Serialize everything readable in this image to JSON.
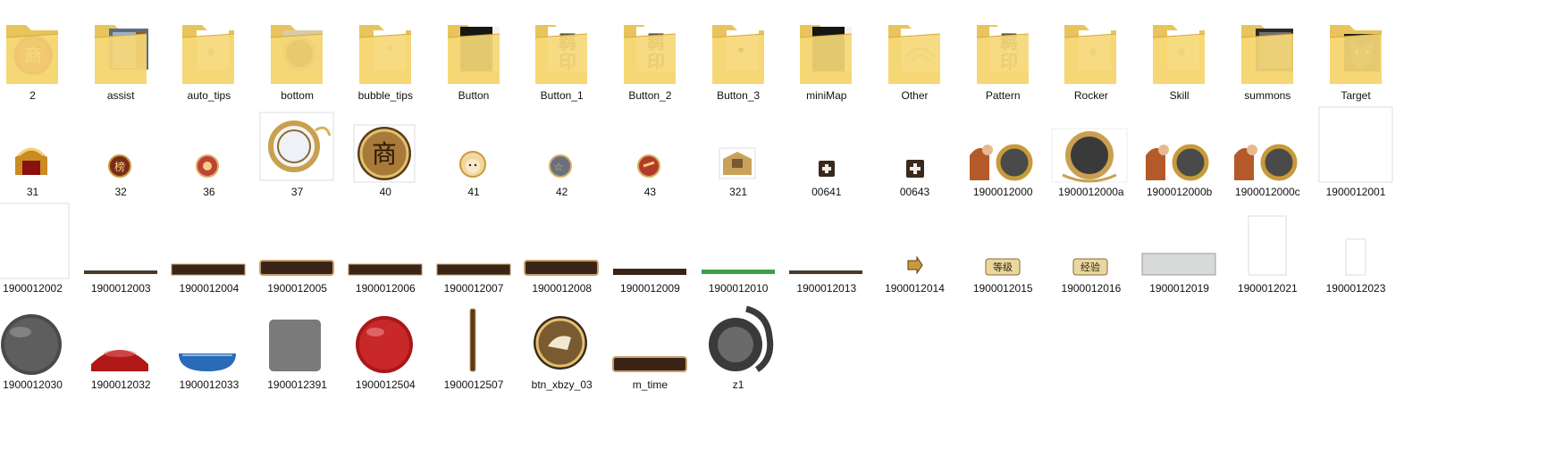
{
  "explorer": {
    "rows": [
      {
        "items": [
          {
            "name": "2",
            "kind": "folder",
            "preview": "red-seal",
            "icon": "folder-icon"
          },
          {
            "name": "assist",
            "kind": "folder",
            "preview": "steel-panel",
            "icon": "folder-icon"
          },
          {
            "name": "auto_tips",
            "kind": "folder",
            "preview": "small-dot",
            "icon": "folder-icon"
          },
          {
            "name": "bottom",
            "kind": "folder",
            "preview": "bronze-ring",
            "icon": "folder-icon"
          },
          {
            "name": "bubble_tips",
            "kind": "folder",
            "preview": "gold-dot",
            "icon": "folder-icon"
          },
          {
            "name": "Button",
            "kind": "folder",
            "preview": "dark-panel",
            "icon": "folder-icon"
          },
          {
            "name": "Button_1",
            "kind": "folder",
            "preview": "gold-glyphs",
            "icon": "folder-icon"
          },
          {
            "name": "Button_2",
            "kind": "folder",
            "preview": "gold-glyphs",
            "icon": "folder-icon"
          },
          {
            "name": "Button_3",
            "kind": "folder",
            "preview": "dark-dot",
            "icon": "folder-icon"
          },
          {
            "name": "miniMap",
            "kind": "folder",
            "preview": "dark-panel",
            "icon": "folder-icon"
          },
          {
            "name": "Other",
            "kind": "folder",
            "preview": "wifi-arcs",
            "icon": "folder-icon"
          },
          {
            "name": "Pattern",
            "kind": "folder",
            "preview": "gold-glyphs",
            "icon": "folder-icon"
          },
          {
            "name": "Rocker",
            "kind": "folder",
            "preview": "small-dot",
            "icon": "folder-icon"
          },
          {
            "name": "Skill",
            "kind": "folder",
            "preview": "small-dot",
            "icon": "folder-icon"
          },
          {
            "name": "summons",
            "kind": "folder",
            "preview": "grey-panel",
            "icon": "folder-icon"
          },
          {
            "name": "Target",
            "kind": "folder",
            "preview": "wolf-head",
            "icon": "folder-icon"
          }
        ]
      },
      {
        "items": [
          {
            "name": "31",
            "kind": "image",
            "preview": "gold-gate",
            "icon": "image-thumbnail"
          },
          {
            "name": "32",
            "kind": "image",
            "preview": "rank-badge",
            "icon": "image-thumbnail"
          },
          {
            "name": "36",
            "kind": "image",
            "preview": "pig-badge",
            "icon": "image-thumbnail"
          },
          {
            "name": "37",
            "kind": "image",
            "preview": "gold-ring-large",
            "icon": "image-thumbnail"
          },
          {
            "name": "40",
            "kind": "image",
            "preview": "shop-coin",
            "icon": "image-thumbnail",
            "glyph": "商"
          },
          {
            "name": "41",
            "kind": "image",
            "preview": "face-badge",
            "icon": "image-thumbnail"
          },
          {
            "name": "42",
            "kind": "image",
            "preview": "gift-badge",
            "icon": "image-thumbnail"
          },
          {
            "name": "43",
            "kind": "image",
            "preview": "hands-badge",
            "icon": "image-thumbnail"
          },
          {
            "name": "321",
            "kind": "image",
            "preview": "gold-gate-small",
            "icon": "image-thumbnail"
          },
          {
            "name": "00641",
            "kind": "image",
            "preview": "plus-box",
            "icon": "image-thumbnail"
          },
          {
            "name": "00643",
            "kind": "image",
            "preview": "plus-box-lg",
            "icon": "image-thumbnail"
          },
          {
            "name": "1900012000",
            "kind": "image",
            "preview": "warrior-ring",
            "icon": "image-thumbnail"
          },
          {
            "name": "1900012000a",
            "kind": "image",
            "preview": "ring-frame",
            "icon": "image-thumbnail"
          },
          {
            "name": "1900012000b",
            "kind": "image",
            "preview": "warrior-ring",
            "icon": "image-thumbnail"
          },
          {
            "name": "1900012000c",
            "kind": "image",
            "preview": "warrior-ring",
            "icon": "image-thumbnail"
          },
          {
            "name": "1900012001",
            "kind": "image",
            "preview": "blank-tall",
            "icon": "image-thumbnail"
          }
        ]
      },
      {
        "items": [
          {
            "name": "1900012002",
            "kind": "image",
            "preview": "blank-square",
            "icon": "image-thumbnail"
          },
          {
            "name": "1900012003",
            "kind": "image",
            "preview": "thin-bar",
            "icon": "image-thumbnail"
          },
          {
            "name": "1900012004",
            "kind": "image",
            "preview": "brown-bar",
            "icon": "image-thumbnail"
          },
          {
            "name": "1900012005",
            "kind": "image",
            "preview": "brown-bar-rounded",
            "icon": "image-thumbnail"
          },
          {
            "name": "1900012006",
            "kind": "image",
            "preview": "brown-bar",
            "icon": "image-thumbnail"
          },
          {
            "name": "1900012007",
            "kind": "image",
            "preview": "brown-bar",
            "icon": "image-thumbnail"
          },
          {
            "name": "1900012008",
            "kind": "image",
            "preview": "brown-bar-rounded",
            "icon": "image-thumbnail"
          },
          {
            "name": "1900012009",
            "kind": "image",
            "preview": "brown-bar-thin",
            "icon": "image-thumbnail"
          },
          {
            "name": "1900012010",
            "kind": "image",
            "preview": "green-bar",
            "icon": "image-thumbnail"
          },
          {
            "name": "1900012013",
            "kind": "image",
            "preview": "thin-bar",
            "icon": "image-thumbnail"
          },
          {
            "name": "1900012014",
            "kind": "image",
            "preview": "arrow-badge",
            "icon": "image-thumbnail"
          },
          {
            "name": "1900012015",
            "kind": "image",
            "preview": "text-badge",
            "icon": "image-thumbnail",
            "glyph": "等级"
          },
          {
            "name": "1900012016",
            "kind": "image",
            "preview": "text-badge",
            "icon": "image-thumbnail",
            "glyph": "经验"
          },
          {
            "name": "1900012019",
            "kind": "image",
            "preview": "grey-rect",
            "icon": "image-thumbnail"
          },
          {
            "name": "1900012021",
            "kind": "image",
            "preview": "blank-tall-small",
            "icon": "image-thumbnail"
          },
          {
            "name": "1900012023",
            "kind": "image",
            "preview": "blank-small",
            "icon": "image-thumbnail"
          }
        ]
      },
      {
        "items": [
          {
            "name": "1900012030",
            "kind": "image",
            "preview": "dark-orb",
            "icon": "image-thumbnail"
          },
          {
            "name": "1900012032",
            "kind": "image",
            "preview": "red-half-orb",
            "icon": "image-thumbnail"
          },
          {
            "name": "1900012033",
            "kind": "image",
            "preview": "blue-half-orb",
            "icon": "image-thumbnail"
          },
          {
            "name": "1900012391",
            "kind": "image",
            "preview": "grey-square",
            "icon": "image-thumbnail"
          },
          {
            "name": "1900012504",
            "kind": "image",
            "preview": "red-orb",
            "icon": "image-thumbnail"
          },
          {
            "name": "1900012507",
            "kind": "image",
            "preview": "vertical-bar",
            "icon": "image-thumbnail"
          },
          {
            "name": "btn_xbzy_03",
            "kind": "image",
            "preview": "hand-coin",
            "icon": "image-thumbnail"
          },
          {
            "name": "m_time",
            "kind": "image",
            "preview": "brown-bar-rounded",
            "icon": "image-thumbnail"
          },
          {
            "name": "z1",
            "kind": "image",
            "preview": "dragon-disc",
            "icon": "image-thumbnail"
          }
        ]
      }
    ]
  }
}
